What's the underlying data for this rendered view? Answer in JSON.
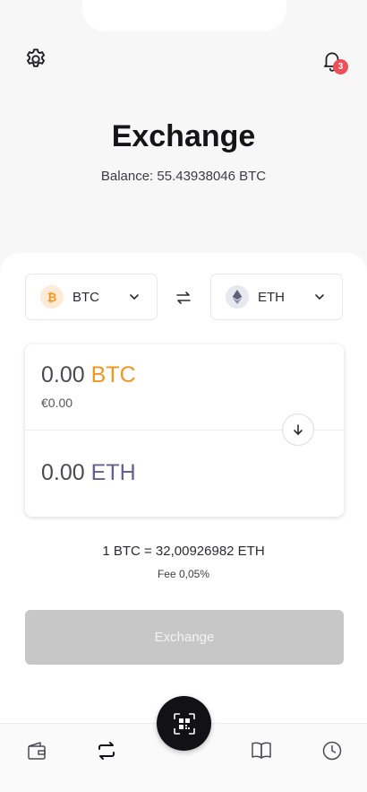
{
  "header": {
    "title": "Exchange",
    "balance": "Balance: 55.43938046 BTC",
    "notification_count": "3"
  },
  "icons": {
    "settings": "gear-icon",
    "notifications": "bell-icon",
    "swap": "swap-arrows-icon",
    "down": "arrow-down-icon",
    "scan": "qr-scan-icon"
  },
  "selectors": {
    "from": {
      "symbol": "BTC",
      "coin_glyph": "₿",
      "color": "#f3951f"
    },
    "to": {
      "symbol": "ETH",
      "color": "#616192"
    }
  },
  "amounts": {
    "from_value": "0.00",
    "from_currency": "BTC",
    "from_fiat": "€0.00",
    "to_value": "0.00",
    "to_currency": "ETH"
  },
  "rate": "1 BTC = 32,00926982 ETH",
  "fee": "Fee 0,05%",
  "exchange_button": "Exchange",
  "tabbar": {
    "items": [
      {
        "name": "wallet",
        "icon": "wallet-icon"
      },
      {
        "name": "exchange",
        "icon": "swap-icon"
      },
      {
        "name": "book",
        "icon": "book-icon"
      },
      {
        "name": "history",
        "icon": "clock-icon"
      }
    ]
  }
}
